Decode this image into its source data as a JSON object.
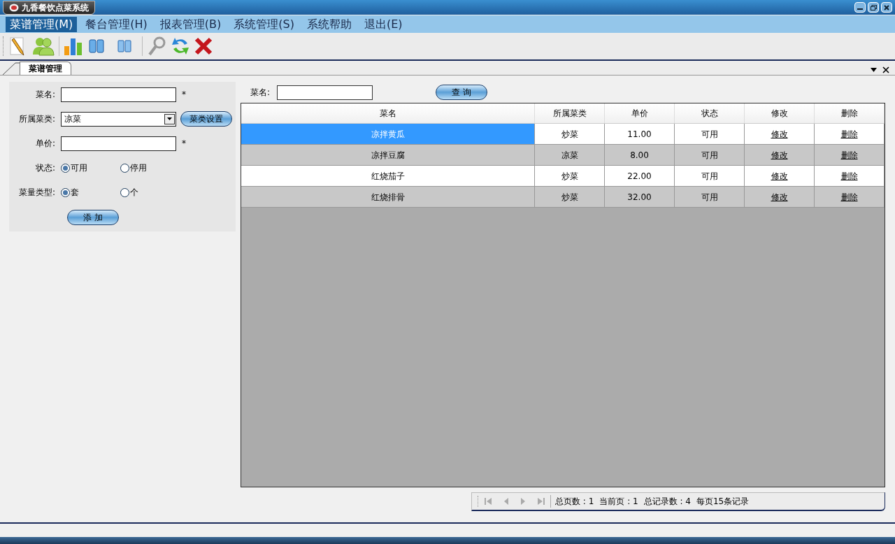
{
  "window": {
    "title": "九香餐饮点菜系统"
  },
  "menu": [
    {
      "label": "菜谱管理(M)",
      "selected": true
    },
    {
      "label": "餐台管理(H)",
      "selected": false
    },
    {
      "label": "报表管理(B)",
      "selected": false
    },
    {
      "label": "系统管理(S)",
      "selected": false
    },
    {
      "label": "系统帮助",
      "selected": false
    },
    {
      "label": "退出(E)",
      "selected": false
    }
  ],
  "tab": {
    "label": "菜谱管理"
  },
  "form": {
    "name": {
      "label": "菜名:",
      "required_mark": "*"
    },
    "category": {
      "label": "所属菜类:",
      "value": "凉菜",
      "button": "菜类设置"
    },
    "price": {
      "label": "单价:",
      "required_mark": "*"
    },
    "status": {
      "label": "状态:",
      "options": [
        {
          "label": "可用",
          "selected": true
        },
        {
          "label": "停用",
          "selected": false
        }
      ]
    },
    "unit_type": {
      "label": "菜量类型:",
      "options": [
        {
          "label": "套",
          "selected": true
        },
        {
          "label": "个",
          "selected": false
        }
      ]
    },
    "add_button": "添 加"
  },
  "search": {
    "label": "菜名:",
    "button": "查 询"
  },
  "table": {
    "columns": [
      "菜名",
      "所属菜类",
      "单价",
      "状态",
      "修改",
      "删除"
    ],
    "rows": [
      {
        "cells": [
          "凉拌黄瓜",
          "炒菜",
          "11.00",
          "可用",
          "修改",
          "删除"
        ],
        "selected": true
      },
      {
        "cells": [
          "凉拌豆腐",
          "凉菜",
          "8.00",
          "可用",
          "修改",
          "删除"
        ],
        "selected": false
      },
      {
        "cells": [
          "红烧茄子",
          "炒菜",
          "22.00",
          "可用",
          "修改",
          "删除"
        ],
        "selected": false
      },
      {
        "cells": [
          "红烧排骨",
          "炒菜",
          "32.00",
          "可用",
          "修改",
          "删除"
        ],
        "selected": false
      }
    ]
  },
  "pager": [
    "总页数 : 1",
    "当前页 : 1",
    "总记录数 : 4",
    "每页15条记录"
  ]
}
